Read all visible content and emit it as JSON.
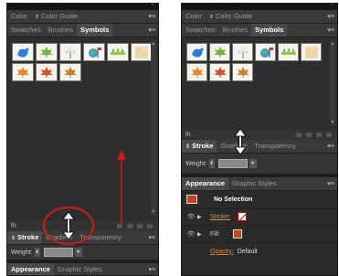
{
  "left_panel": {
    "tabs_top": [
      {
        "label": "Color",
        "active": false
      },
      {
        "label": "Color Guide",
        "active": false
      }
    ],
    "tabs_second": [
      {
        "label": "Swatches",
        "active": false
      },
      {
        "label": "Brushes",
        "active": false
      },
      {
        "label": "Symbols",
        "active": true
      }
    ],
    "lib_button": "lh.",
    "stroke_tabs": [
      {
        "label": "Stroke",
        "active": true
      },
      {
        "label": "Gradient",
        "active": false
      },
      {
        "label": "Transparency",
        "active": false
      }
    ],
    "weight_label": "Weight:",
    "bottom_tabs": [
      {
        "label": "Appearance",
        "active": true
      },
      {
        "label": "Graphic Styles",
        "active": false
      }
    ]
  },
  "right_panel": {
    "tabs_top": [
      {
        "label": "Color",
        "active": false
      },
      {
        "label": "Color Guide",
        "active": false
      }
    ],
    "tabs_second": [
      {
        "label": "Swatches",
        "active": false
      },
      {
        "label": "Brushes",
        "active": false
      },
      {
        "label": "Symbols",
        "active": true
      }
    ],
    "lib_button": "lh.",
    "stroke_tabs": [
      {
        "label": "Stroke",
        "active": true
      },
      {
        "label": "Gradient",
        "active": false
      },
      {
        "label": "Transparency",
        "active": false
      }
    ],
    "weight_label": "Weight:",
    "appearance_tabs": [
      {
        "label": "Appearance",
        "active": true
      },
      {
        "label": "Graphic Styles",
        "active": false
      }
    ],
    "appearance_rows": {
      "selection": "No Selection",
      "stroke_label": "Stroke:",
      "fill_label": "Fill:",
      "opacity_label": "Opacity:",
      "opacity_value": "Default"
    }
  },
  "symbols": [
    "blue-splash",
    "maple-leaf-green",
    "flowers",
    "globe-flag",
    "grass-bar",
    "texture-tile",
    "autumn-leaf-orange",
    "autumn-leaf-red",
    "autumn-leaf-brown"
  ],
  "colors": {
    "annotation": "#d01a1a",
    "panel_bg": "#2b2b2b",
    "accent_orange": "#c8441c"
  }
}
